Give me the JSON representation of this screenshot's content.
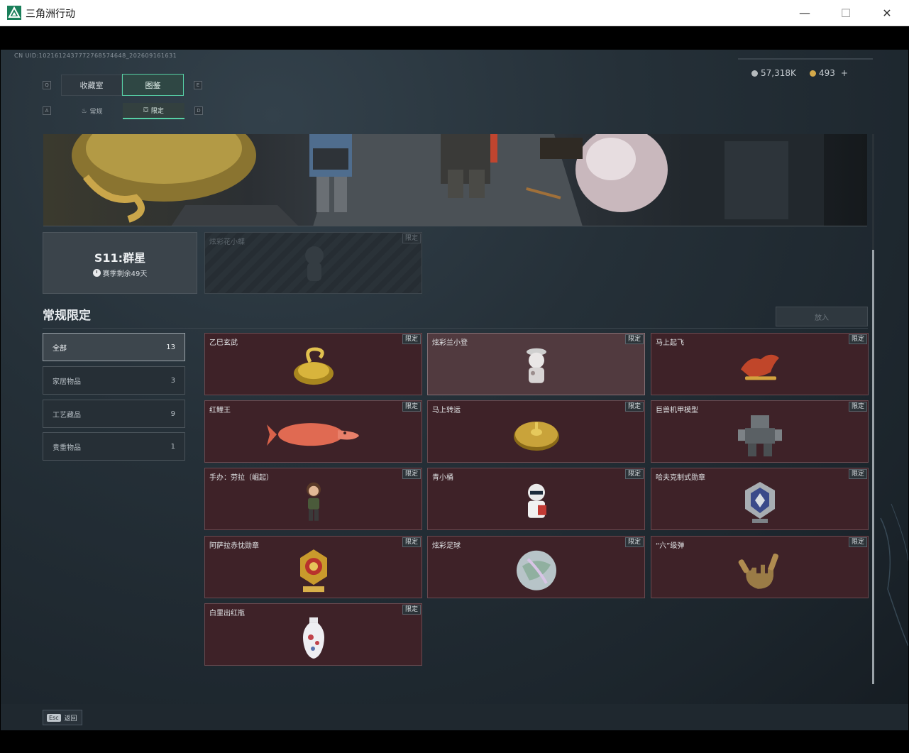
{
  "window": {
    "title": "三角洲行动",
    "minimize": "—",
    "maximize": "☐",
    "close": "✕"
  },
  "uid": "CN UID:1021612437772768574648_202609161631",
  "currency": [
    {
      "icon": "silver-coin-icon",
      "value": "57,318K",
      "color": "#b5babd"
    },
    {
      "icon": "gold-coin-icon",
      "value": "493",
      "plus": "+",
      "color": "#d4a94a"
    }
  ],
  "keys": {
    "q": "Q",
    "e": "E",
    "a": "A",
    "d": "D"
  },
  "tabs": [
    {
      "label": "收藏室"
    },
    {
      "label": "图鉴"
    }
  ],
  "subtabs": [
    {
      "label": "常规"
    },
    {
      "label": "限定"
    }
  ],
  "season": {
    "title": "S11:群星",
    "remaining": "赛季剩余49天"
  },
  "locked_item": {
    "name": "炫彩花小蝶",
    "badge": "限定"
  },
  "section": {
    "title": "常规限定",
    "place_button": "放入"
  },
  "categories": [
    {
      "label": "全部",
      "count": "13"
    },
    {
      "label": "家居物品",
      "count": "3"
    },
    {
      "label": "工艺藏品",
      "count": "9"
    },
    {
      "label": "贵重物品",
      "count": "1"
    }
  ],
  "items": [
    {
      "name": "乙巳玄武",
      "badge": "限定",
      "icon": "golden-turtle-icon"
    },
    {
      "name": "炫彩兰小登",
      "badge": "限定",
      "icon": "figurine-icon"
    },
    {
      "name": "马上起飞",
      "badge": "限定",
      "icon": "red-horse-icon"
    },
    {
      "name": "红鲤王",
      "badge": "限定",
      "icon": "koi-fish-icon"
    },
    {
      "name": "马上转运",
      "badge": "限定",
      "icon": "golden-disc-icon"
    },
    {
      "name": "巨兽机甲模型",
      "badge": "限定",
      "icon": "mech-model-icon"
    },
    {
      "name": "手办：劳拉（崛起）",
      "badge": "限定",
      "icon": "lara-figure-icon"
    },
    {
      "name": "青小桶",
      "badge": "限定",
      "icon": "bucket-figure-icon"
    },
    {
      "name": "哈夫克制式勋章",
      "badge": "限定",
      "icon": "medal-icon"
    },
    {
      "name": "阿萨拉赤忱勋章",
      "badge": "限定",
      "icon": "gold-medal-icon"
    },
    {
      "name": "炫彩足球",
      "badge": "限定",
      "icon": "football-icon"
    },
    {
      "name": "“六”级弹",
      "badge": "限定",
      "icon": "hand-sign-icon"
    },
    {
      "name": "白里出红瓶",
      "badge": "限定",
      "icon": "porcelain-vase-icon"
    }
  ],
  "footer": {
    "esc_key": "Esc",
    "esc_label": "返回"
  }
}
